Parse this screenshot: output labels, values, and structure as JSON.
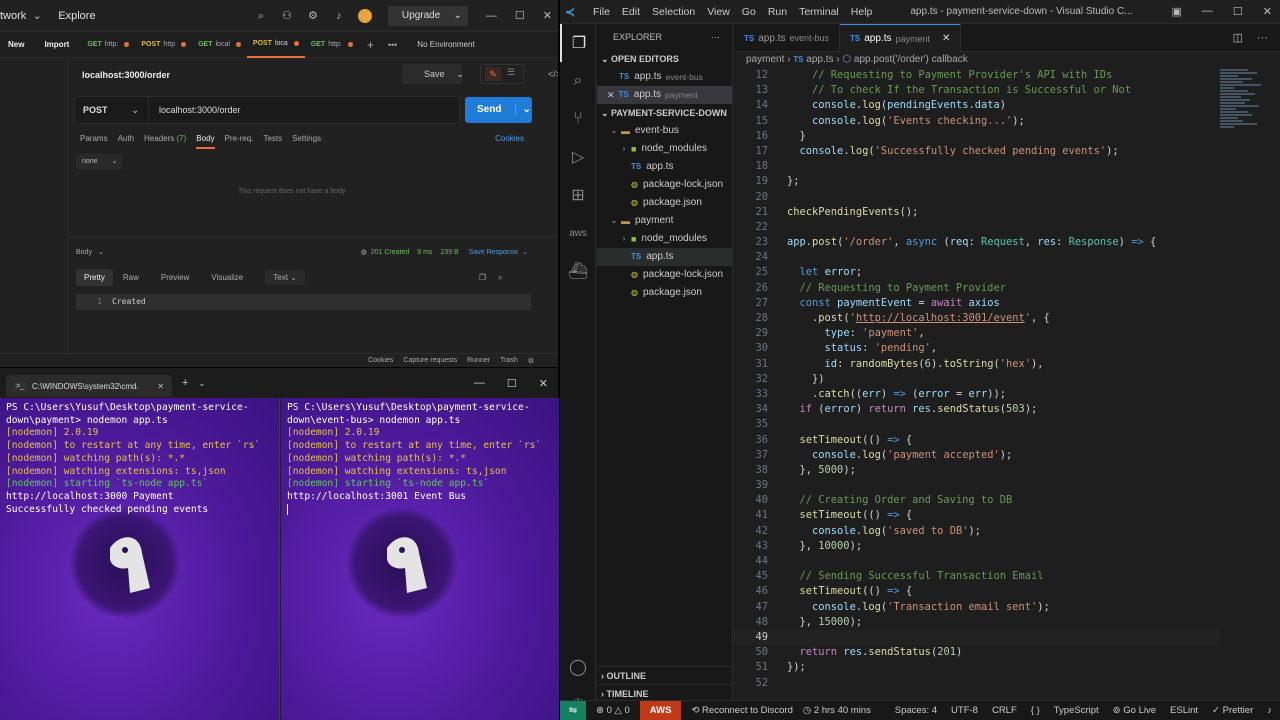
{
  "postman": {
    "nav_title": "twork",
    "explore": "Explore",
    "upgrade": "Upgrade",
    "new_btn": "New",
    "import_btn": "Import",
    "tabs": [
      {
        "method": "GET",
        "label": "http:"
      },
      {
        "method": "POST",
        "label": "http"
      },
      {
        "method": "GET",
        "label": "local"
      },
      {
        "method": "POST",
        "label": "loca"
      },
      {
        "method": "GET",
        "label": "http:"
      }
    ],
    "environment": "No Environment",
    "request_name": "localhost:3000/order",
    "save": "Save",
    "method": "POST",
    "url": "localhost:3000/order",
    "send": "Send",
    "req_tabs": [
      "Params",
      "Auth",
      "Headers",
      "Body",
      "Pre-req.",
      "Tests",
      "Settings"
    ],
    "headers_count": "(7)",
    "cookies": "Cookies",
    "body_type": "none",
    "empty_body": "This request does not have a body",
    "response_label": "Body",
    "status": "201 Created",
    "time": "9 ms",
    "size": "239 B",
    "save_response": "Save Response",
    "res_tabs": [
      "Pretty",
      "Raw",
      "Preview",
      "Visualize"
    ],
    "res_format": "Text",
    "res_line_no": "1",
    "res_body": "Created",
    "footer": [
      "Cookies",
      "Capture requests",
      "Runner",
      "Trash"
    ]
  },
  "terminal": {
    "tab_title": "C:\\WINDOWS\\system32\\cmd.",
    "left_lines": [
      {
        "t": "w",
        "s": "PS C:\\Users\\Yusuf\\Desktop\\payment-service-down\\payment> nodemon app.ts"
      },
      {
        "t": "y",
        "s": "[nodemon] 2.0.19"
      },
      {
        "t": "y",
        "s": "[nodemon] to restart at any time, enter `rs`"
      },
      {
        "t": "y",
        "s": "[nodemon] watching path(s): *.*"
      },
      {
        "t": "y",
        "s": "[nodemon] watching extensions: ts,json"
      },
      {
        "t": "g",
        "s": "[nodemon] starting `ts-node app.ts`"
      },
      {
        "t": "w",
        "s": "http://localhost:3000 Payment"
      },
      {
        "t": "w",
        "s": "Successfully checked pending events"
      }
    ],
    "right_lines": [
      {
        "t": "w",
        "s": "PS C:\\Users\\Yusuf\\Desktop\\payment-service-down\\event-bus> nodemon app.ts"
      },
      {
        "t": "y",
        "s": "[nodemon] 2.0.19"
      },
      {
        "t": "y",
        "s": "[nodemon] to restart at any time, enter `rs`"
      },
      {
        "t": "y",
        "s": "[nodemon] watching path(s): *.*"
      },
      {
        "t": "y",
        "s": "[nodemon] watching extensions: ts,json"
      },
      {
        "t": "g",
        "s": "[nodemon] starting `ts-node app.ts`"
      },
      {
        "t": "w",
        "s": "http://localhost:3001 Event Bus"
      }
    ]
  },
  "vscode": {
    "menu": [
      "File",
      "Edit",
      "Selection",
      "View",
      "Go",
      "Run",
      "Terminal",
      "Help"
    ],
    "window_title": "app.ts - payment-service-down - Visual Studio C...",
    "explorer_title": "EXPLORER",
    "open_editors": "OPEN EDITORS",
    "open_files": [
      {
        "name": "app.ts",
        "sub": "event-bus"
      },
      {
        "name": "app.ts",
        "sub": "payment"
      }
    ],
    "project": "PAYMENT-SERVICE-DOWN",
    "tree": [
      {
        "name": "event-bus",
        "kind": "folder",
        "depth": 1,
        "chev": "v"
      },
      {
        "name": "node_modules",
        "kind": "gfolder",
        "depth": 2,
        "chev": ">"
      },
      {
        "name": "app.ts",
        "kind": "ts",
        "depth": 2,
        "chev": ""
      },
      {
        "name": "package-lock.json",
        "kind": "json",
        "depth": 2,
        "chev": ""
      },
      {
        "name": "package.json",
        "kind": "json",
        "depth": 2,
        "chev": ""
      },
      {
        "name": "payment",
        "kind": "folder",
        "depth": 1,
        "chev": "v"
      },
      {
        "name": "node_modules",
        "kind": "gfolder",
        "depth": 2,
        "chev": ">"
      },
      {
        "name": "app.ts",
        "kind": "ts",
        "depth": 2,
        "chev": "",
        "selected": true
      },
      {
        "name": "package-lock.json",
        "kind": "json",
        "depth": 2,
        "chev": ""
      },
      {
        "name": "package.json",
        "kind": "json",
        "depth": 2,
        "chev": ""
      }
    ],
    "outline": "OUTLINE",
    "timeline": "TIMELINE",
    "editor_tabs": [
      {
        "name": "app.ts",
        "sub": "event-bus",
        "active": false
      },
      {
        "name": "app.ts",
        "sub": "payment",
        "active": true
      }
    ],
    "breadcrumb": [
      "payment",
      "app.ts",
      "app.post('/order') callback"
    ],
    "current_line": 49,
    "code": [
      {
        "n": 12,
        "h": "    <span class='cm'>// Requesting to Payment Provider's API with IDs</span>"
      },
      {
        "n": 13,
        "h": "    <span class='cm'>// To check If the Transaction is Successful or Not</span>"
      },
      {
        "n": 14,
        "h": "    <span class='var'>console</span>.<span class='fn'>log</span>(<span class='var'>pendingEvents</span>.<span class='var'>data</span>)"
      },
      {
        "n": 15,
        "h": "    <span class='var'>console</span>.<span class='fn'>log</span>(<span class='str'>'Events checking...'</span>);"
      },
      {
        "n": 16,
        "h": "  }"
      },
      {
        "n": 17,
        "h": "  <span class='var'>console</span>.<span class='fn'>log</span>(<span class='str'>'Successfully checked pending events'</span>);"
      },
      {
        "n": 18,
        "h": ""
      },
      {
        "n": 19,
        "h": "};"
      },
      {
        "n": 20,
        "h": ""
      },
      {
        "n": 21,
        "h": "<span class='fn'>checkPendingEvents</span>();"
      },
      {
        "n": 22,
        "h": ""
      },
      {
        "n": 23,
        "h": "<span class='var'>app</span>.<span class='fn'>post</span>(<span class='str'>'/order'</span>, <span class='kw'>async</span> (<span class='var'>req</span>: <span class='typ'>Request</span>, <span class='var'>res</span>: <span class='typ'>Response</span>) <span class='kw'>=&gt;</span> {"
      },
      {
        "n": 24,
        "h": ""
      },
      {
        "n": 25,
        "h": "  <span class='kw'>let</span> <span class='var'>error</span>;"
      },
      {
        "n": 26,
        "h": "  <span class='cm'>// Requesting to Payment Provider</span>"
      },
      {
        "n": 27,
        "h": "  <span class='kw'>const</span> <span class='var'>paymentEvent</span> = <span class='ctl'>await</span> <span class='var'>axios</span>"
      },
      {
        "n": 28,
        "h": "    .<span class='fn'>post</span>(<span class='str'>'</span><span class='lnk'>http://localhost:3001/event</span><span class='str'>'</span>, {"
      },
      {
        "n": 29,
        "h": "      <span class='var'>type</span>: <span class='str'>'payment'</span>,"
      },
      {
        "n": 30,
        "h": "      <span class='var'>status</span>: <span class='str'>'pending'</span>,"
      },
      {
        "n": 31,
        "h": "      <span class='var'>id</span>: <span class='fn'>randomBytes</span>(<span class='num'>6</span>).<span class='fn'>toString</span>(<span class='str'>'hex'</span>),"
      },
      {
        "n": 32,
        "h": "    })"
      },
      {
        "n": 33,
        "h": "    .<span class='fn'>catch</span>((<span class='var'>err</span>) <span class='kw'>=&gt;</span> (<span class='var'>error</span> = <span class='var'>err</span>));"
      },
      {
        "n": 34,
        "h": "  <span class='ctl'>if</span> (<span class='var'>error</span>) <span class='ctl'>return</span> <span class='var'>res</span>.<span class='fn'>sendStatus</span>(<span class='num'>503</span>);"
      },
      {
        "n": 35,
        "h": ""
      },
      {
        "n": 36,
        "h": "  <span class='fn'>setTimeout</span>(() <span class='kw'>=&gt;</span> {"
      },
      {
        "n": 37,
        "h": "    <span class='var'>console</span>.<span class='fn'>log</span>(<span class='str'>'payment accepted'</span>);"
      },
      {
        "n": 38,
        "h": "  }, <span class='num'>5000</span>);"
      },
      {
        "n": 39,
        "h": ""
      },
      {
        "n": 40,
        "h": "  <span class='cm'>// Creating Order and Saving to DB</span>"
      },
      {
        "n": 41,
        "h": "  <span class='fn'>setTimeout</span>(() <span class='kw'>=&gt;</span> {"
      },
      {
        "n": 42,
        "h": "    <span class='var'>console</span>.<span class='fn'>log</span>(<span class='str'>'saved to DB'</span>);"
      },
      {
        "n": 43,
        "h": "  }, <span class='num'>10000</span>);"
      },
      {
        "n": 44,
        "h": ""
      },
      {
        "n": 45,
        "h": "  <span class='cm'>// Sending Successful Transaction Email</span>"
      },
      {
        "n": 46,
        "h": "  <span class='fn'>setTimeout</span>(() <span class='kw'>=&gt;</span> {"
      },
      {
        "n": 47,
        "h": "    <span class='var'>console</span>.<span class='fn'>log</span>(<span class='str'>'Transaction email sent'</span>);"
      },
      {
        "n": 48,
        "h": "  }, <span class='num'>15000</span>);"
      },
      {
        "n": 49,
        "h": ""
      },
      {
        "n": 50,
        "h": "  <span class='ctl'>return</span> <span class='var'>res</span>.<span class='fn'>sendStatus</span>(<span class='num'>201</span>)"
      },
      {
        "n": 51,
        "h": "});"
      },
      {
        "n": 52,
        "h": ""
      }
    ],
    "status": {
      "errors": "0",
      "warnings": "0",
      "aws": "AWS",
      "discord": "Reconnect to Discord",
      "time": "2 hrs 40 mins",
      "right": [
        "Spaces: 4",
        "UTF-8",
        "CRLF",
        "{ }",
        "TypeScript",
        "Go Live",
        "ESLint",
        "Prettier"
      ]
    }
  }
}
